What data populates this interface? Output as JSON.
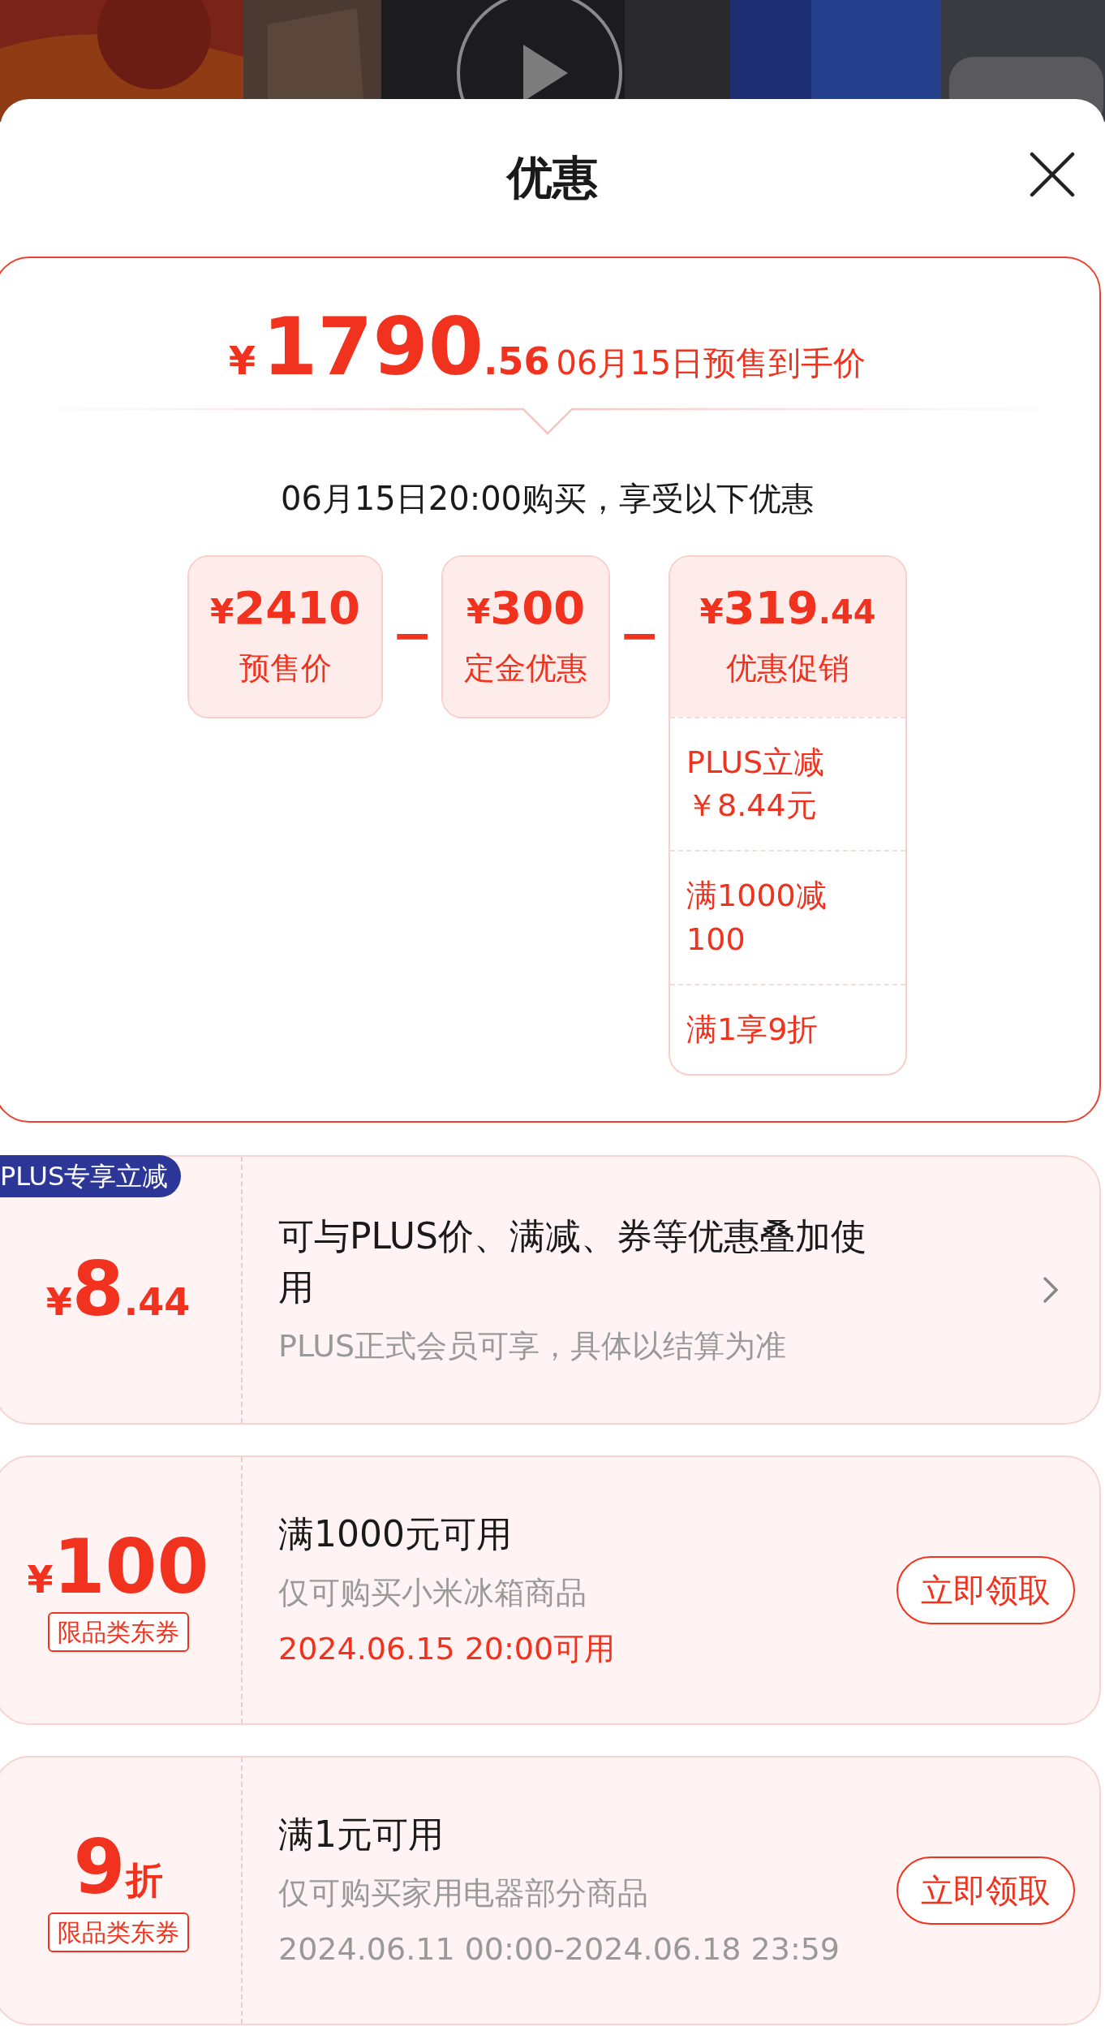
{
  "sheet": {
    "title": "优惠"
  },
  "summary": {
    "currency": "¥",
    "price_integer": "1790",
    "price_decimal": ".56",
    "price_label": "06月15日预售到手价",
    "intro": "06月15日20:00购买，享受以下优惠",
    "parts": [
      {
        "currency": "¥",
        "amount": "2410",
        "label": "预售价"
      },
      {
        "operator": "−",
        "currency": "¥",
        "amount": "300",
        "label": "定金优惠"
      },
      {
        "operator": "−",
        "currency": "¥",
        "amount": "319",
        "decimal": ".44",
        "label": "优惠促销",
        "details": [
          "PLUS立减￥8.44元",
          "满1000减100",
          "满1享9折"
        ]
      }
    ]
  },
  "coupons": [
    {
      "kind": "plus",
      "badge": "PLUS专享立减",
      "currency": "¥",
      "amount": "8",
      "decimal": ".44",
      "title": "可与PLUS价、满减、券等优惠叠加使用",
      "description": "PLUS正式会员可享，具体以结算为准"
    },
    {
      "kind": "coupon",
      "currency": "¥",
      "amount": "100",
      "tag": "限品类东券",
      "title": "满1000元可用",
      "description": "仅可购买小米冰箱商品",
      "date": "2024.06.15 20:00可用",
      "date_highlight": true,
      "button": "立即领取"
    },
    {
      "kind": "coupon",
      "amount": "9",
      "unit": "折",
      "tag": "限品类东券",
      "title": "满1元可用",
      "description": "仅可购买家用电器部分商品",
      "date": "2024.06.11 00:00-2024.06.18 23:59",
      "date_highlight": false,
      "button": "立即领取"
    }
  ]
}
